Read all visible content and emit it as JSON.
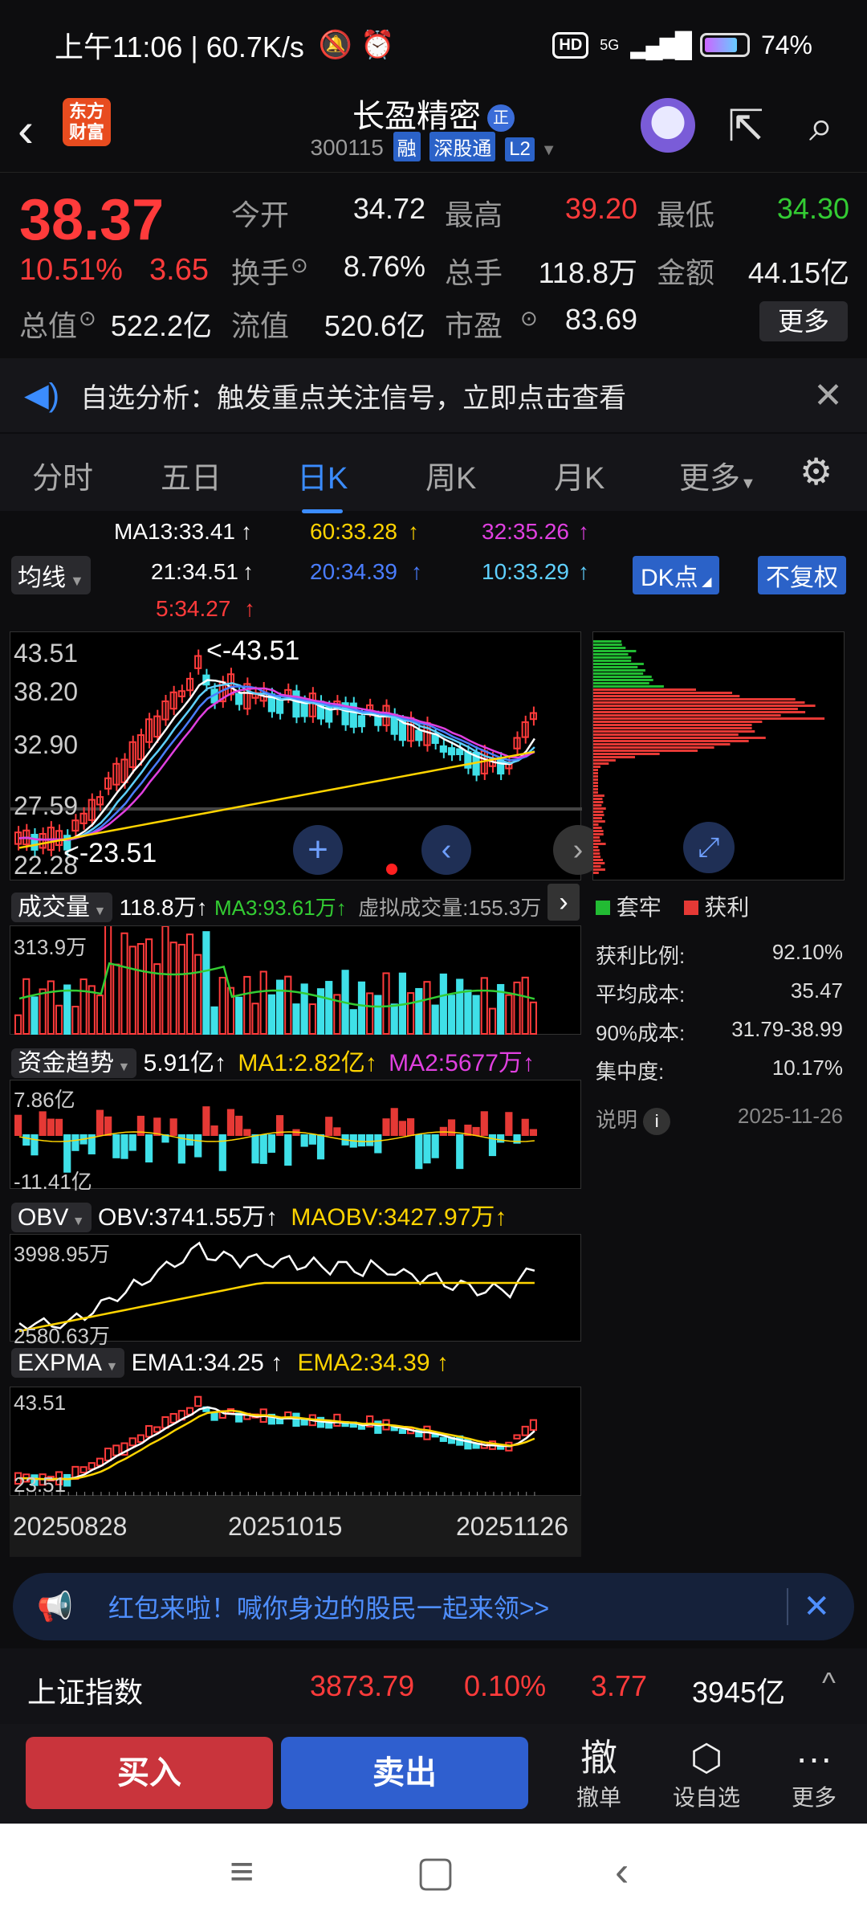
{
  "status": {
    "time": "上午11:06 | 60.7K/s",
    "battery": "74%",
    "net": "5G"
  },
  "header": {
    "logo_line1": "东方",
    "logo_line2": "财富",
    "name": "长盈精密",
    "zheng": "正",
    "code": "300115",
    "tag1": "融",
    "tag2": "深股通",
    "tag3": "L2"
  },
  "quote": {
    "price": "38.37",
    "pct": "10.51%",
    "chg": "3.65",
    "rows": [
      [
        {
          "l": "今开",
          "v": "34.72"
        },
        {
          "l": "最高",
          "v": "39.20"
        },
        {
          "l": "最低",
          "v": "34.30"
        }
      ],
      [
        {
          "l": "换手",
          "v": "8.76%"
        },
        {
          "l": "总手",
          "v": "118.8万"
        },
        {
          "l": "金额",
          "v": "44.15亿"
        }
      ],
      [
        {
          "l": "总值",
          "v": "522.2亿"
        },
        {
          "l": "流值",
          "v": "520.6亿"
        },
        {
          "l": "市盈",
          "v": "83.69"
        }
      ]
    ],
    "more": "更多"
  },
  "notice": "自选分析：触发重点关注信号，立即点击查看",
  "tabs": [
    "分时",
    "五日",
    "日K",
    "周K",
    "月K",
    "更多"
  ],
  "ma": {
    "selector": "均线",
    "ma13": "MA13:33.41",
    "ma60": "60:33.28",
    "ma32": "32:35.26",
    "ma21": "21:34.51",
    "ma20": "20:34.39",
    "ma10": "10:33.29",
    "ma5": "5:34.27",
    "dk": "DK点",
    "fq": "不复权"
  },
  "kline": {
    "axis": [
      "43.51",
      "38.20",
      "32.90",
      "27.59",
      "22.28"
    ],
    "hi_label": "<-43.51",
    "lo_label": "<-23.51"
  },
  "volume": {
    "selector": "成交量",
    "value": "118.8万",
    "ma3": "MA3:93.61万",
    "virtual": "虚拟成交量:155.3万",
    "axis_top": "313.9万"
  },
  "fund": {
    "selector": "资金趋势",
    "value": "5.91亿",
    "ma1": "MA1:2.82亿",
    "ma2": "MA2:5677万",
    "axis_top": "7.86亿",
    "axis_bot": "-11.41亿"
  },
  "obv": {
    "selector": "OBV",
    "obv": "OBV:3741.55万",
    "maobv": "MAOBV:3427.97万",
    "axis_top": "3998.95万",
    "axis_bot": "2580.63万"
  },
  "expma": {
    "selector": "EXPMA",
    "ema1": "EMA1:34.25",
    "ema2": "EMA2:34.39",
    "axis_top": "43.51",
    "axis_bot": "23.51"
  },
  "dates": [
    "20250828",
    "20251015",
    "20251126"
  ],
  "chip": {
    "legend1": "套牢",
    "legend2": "获利",
    "stats": [
      {
        "l": "获利比例:",
        "v": "92.10%"
      },
      {
        "l": "平均成本:",
        "v": "35.47"
      },
      {
        "l": "90%成本:",
        "v": "31.79-38.99"
      },
      {
        "l": "集中度:",
        "v": "10.17%"
      }
    ],
    "note": "说明",
    "date": "2025-11-26"
  },
  "banner": "红包来啦！喊你身边的股民一起来领>>",
  "index": {
    "name": "上证指数",
    "value": "3873.79",
    "pct": "0.10%",
    "chg": "3.77",
    "amount": "3945亿"
  },
  "actions": {
    "buy": "买入",
    "sell": "卖出",
    "cancel_icon": "撤",
    "cancel": "撤单",
    "watch": "设自选",
    "more": "更多"
  },
  "colors": {
    "up": "#ff3b3b",
    "down": "#33cc33",
    "accent": "#3b8cff"
  }
}
